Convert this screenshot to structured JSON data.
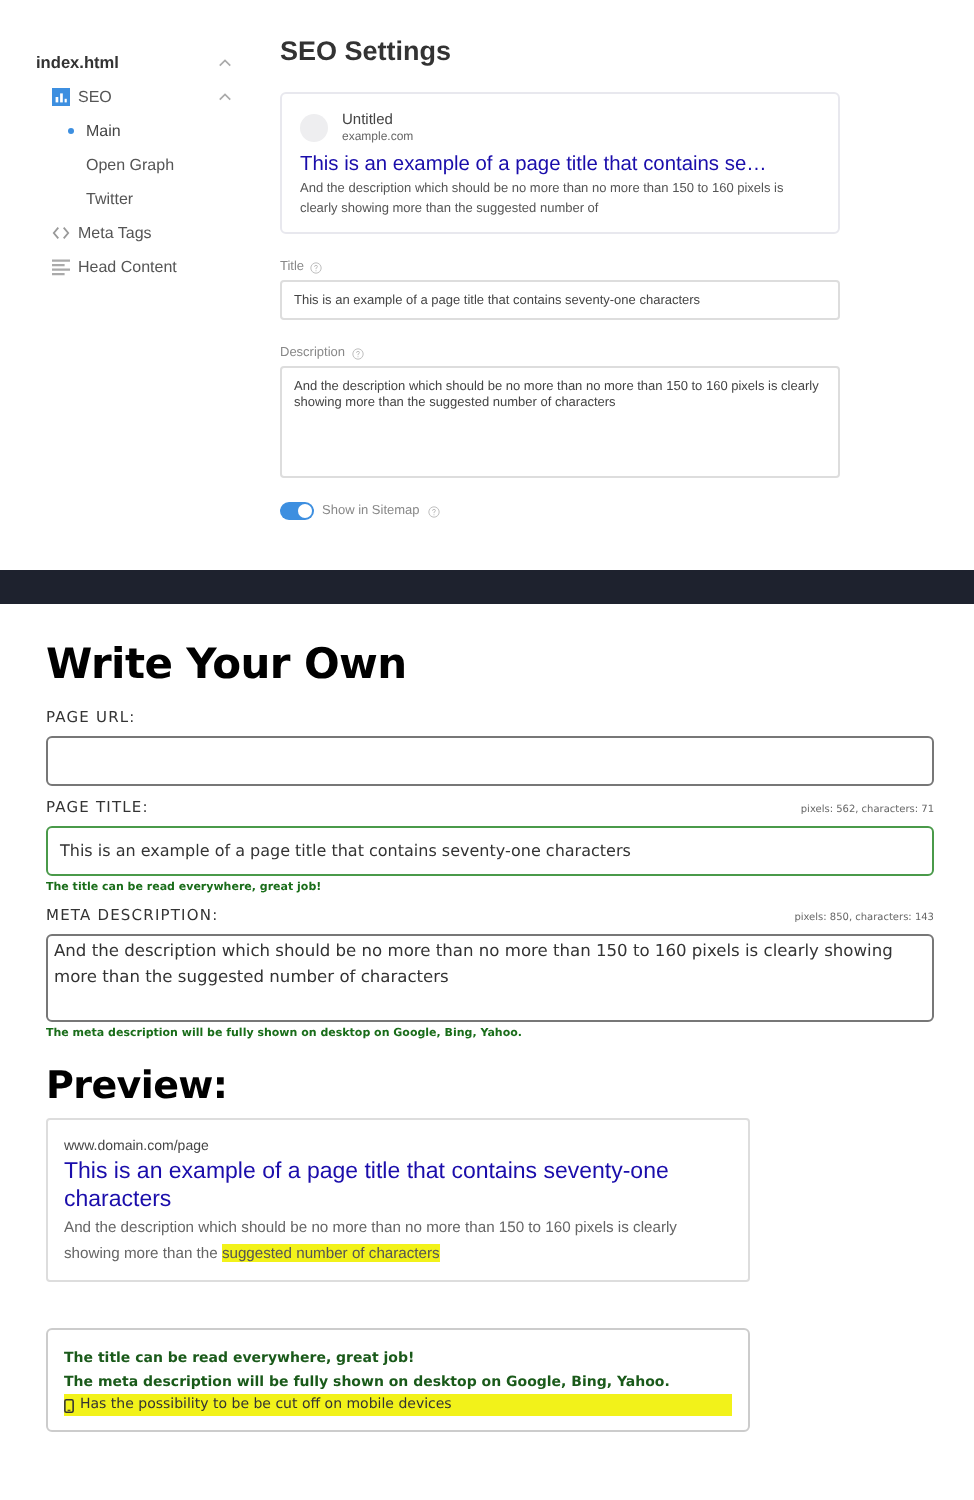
{
  "sidebar": {
    "items": [
      {
        "label": "index.html",
        "expanded": true,
        "children": [
          {
            "label": "SEO",
            "kind": "chart",
            "expanded": true,
            "children": [
              {
                "label": "Main",
                "selected": true
              },
              {
                "label": "Open Graph",
                "selected": false
              },
              {
                "label": "Twitter",
                "selected": false
              }
            ]
          },
          {
            "label": "Meta Tags",
            "kind": "code"
          },
          {
            "label": "Head Content",
            "kind": "lines"
          }
        ]
      }
    ]
  },
  "seo_settings": {
    "title": "SEO Settings",
    "preview": {
      "site_name": "Untitled",
      "domain": "example.com",
      "title": "This is an example of a page title that contains se…",
      "description": "And the description which should be no more than no more than 150 to 160 pixels is clearly showing more than the suggested number of"
    },
    "title_field": {
      "label": "Title",
      "value": "This is an example of a page title that contains seventy-one characters"
    },
    "description_field": {
      "label": "Description",
      "value": "And the description which should be no more than no more than 150 to 160 pixels is clearly showing more than the suggested number of characters"
    },
    "sitemap_toggle": {
      "label": "Show in Sitemap",
      "on": true
    }
  },
  "write_your_own": {
    "heading": "Write Your Own",
    "url_field": {
      "label": "PAGE URL:"
    },
    "title_field": {
      "label": "PAGE TITLE:",
      "stats": "pixels: 562, characters: 71",
      "value": "This is an example of a page title that contains seventy-one characters",
      "valid": true,
      "message": "The title can be read everywhere, great job!"
    },
    "description_field": {
      "label": "META DESCRIPTION:",
      "stats": "pixels: 850, characters: 143",
      "value": "And the description which should be no more than no more than 150 to 160 pixels is clearly showing more than the suggested number of characters",
      "message": "The meta description will be fully shown on desktop on Google, Bing, Yahoo."
    }
  },
  "preview": {
    "heading": "Preview:",
    "url": "www.domain.com/page",
    "title": "This is an example of a page title that contains seventy-one characters",
    "description": [
      {
        "text": "And the description which should be no more than no more than 150 to 160 pixels is clearly showing more than the ",
        "highlighted": false
      },
      {
        "text": "suggested number of characters",
        "highlighted": true
      }
    ]
  },
  "messages": [
    {
      "kind": "ok",
      "text": "The title can be read everywhere, great job!"
    },
    {
      "kind": "ok",
      "text": "The meta description will be fully shown on desktop on Google, Bing, Yahoo."
    },
    {
      "kind": "warning",
      "text": "Has the possibility to be be cut off on mobile devices"
    }
  ]
}
